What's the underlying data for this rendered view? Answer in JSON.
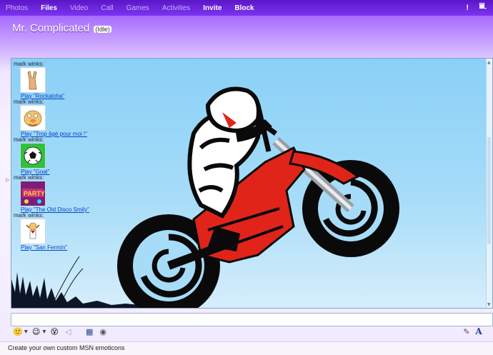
{
  "menu": {
    "items": [
      {
        "label": "Photos",
        "active": false
      },
      {
        "label": "Files",
        "active": true
      },
      {
        "label": "Video",
        "active": false
      },
      {
        "label": "Call",
        "active": false
      },
      {
        "label": "Games",
        "active": false
      },
      {
        "label": "Activities",
        "active": false
      },
      {
        "label": "Invite",
        "active": true
      },
      {
        "label": "Block",
        "active": true
      }
    ],
    "alert_glyph": "!",
    "options_glyph": "▾"
  },
  "contact": {
    "name": "Mr. Complicated",
    "status": "(Idle)"
  },
  "conversation": {
    "messages": [
      {
        "sender": "mark winks:",
        "link": "Play \"Rockaloha\"",
        "emoticon": "rock-hand-icon"
      },
      {
        "sender": "mark winks:",
        "link": "Play \"Trop âgé pour moi !\"",
        "emoticon": "old-man-icon"
      },
      {
        "sender": "mark winks:",
        "link": "Play \"Goal\"",
        "emoticon": "soccer-ball-icon"
      },
      {
        "sender": "mark winks:",
        "link": "Play \"The Old Disco Smily\"",
        "emoticon": "party-icon"
      },
      {
        "sender": "mark winks:",
        "link": "Play \"San Fermín\"",
        "emoticon": "san-fermin-icon"
      }
    ]
  },
  "toolbar": {
    "emoticon_glyph": "🙂",
    "wink_glyph": "😉",
    "nudge_glyph": "😵",
    "voice_clip_glyph": "◁",
    "background_glyph": "▦",
    "games_glyph": "◉",
    "handwriting_glyph": "✎",
    "font_glyph": "A"
  },
  "status_bar": {
    "text": "Create your own custom MSN emoticons"
  },
  "colors": {
    "accent": "#7b34ee",
    "link": "#0645c8",
    "chat_bg": "#8ad0f7",
    "bike_red": "#e0241a"
  }
}
